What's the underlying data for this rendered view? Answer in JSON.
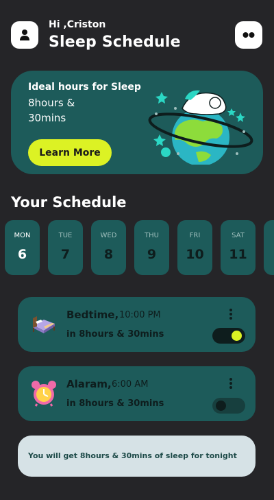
{
  "header": {
    "greeting": "Hi ,Criston",
    "title": "Sleep Schedule",
    "avatar_icon": "user-icon",
    "menu_icon": "dots-icon"
  },
  "hero": {
    "line1": "Ideal hours for Sleep",
    "line2": "8hours &",
    "line3": "30mins",
    "button_label": "Learn More",
    "illustration": "sleeping-on-planet-illustration"
  },
  "schedule": {
    "title": "Your Schedule",
    "days": [
      {
        "name": "MON",
        "date": "6",
        "active": true
      },
      {
        "name": "TUE",
        "date": "7",
        "active": false
      },
      {
        "name": "WED",
        "date": "8",
        "active": false
      },
      {
        "name": "THU",
        "date": "9",
        "active": false
      },
      {
        "name": "FRI",
        "date": "10",
        "active": false
      },
      {
        "name": "SAT",
        "date": "11",
        "active": false
      }
    ]
  },
  "alarms": [
    {
      "title": "Bedtime,",
      "time": "10:00 PM",
      "subtitle": "in 8hours & 30mins",
      "enabled": true,
      "icon": "bed-icon"
    },
    {
      "title": "Alaram,",
      "time": "6:00 AM",
      "subtitle": "in 8hours & 30mins",
      "enabled": false,
      "icon": "alarm-clock-icon"
    }
  ],
  "note": {
    "text": "You will get 8hours & 30mins of sleep for tonight"
  },
  "colors": {
    "background": "#252528",
    "card": "#1d5b5a",
    "accent": "#dcf224",
    "note_bg": "#d6e2e6"
  }
}
